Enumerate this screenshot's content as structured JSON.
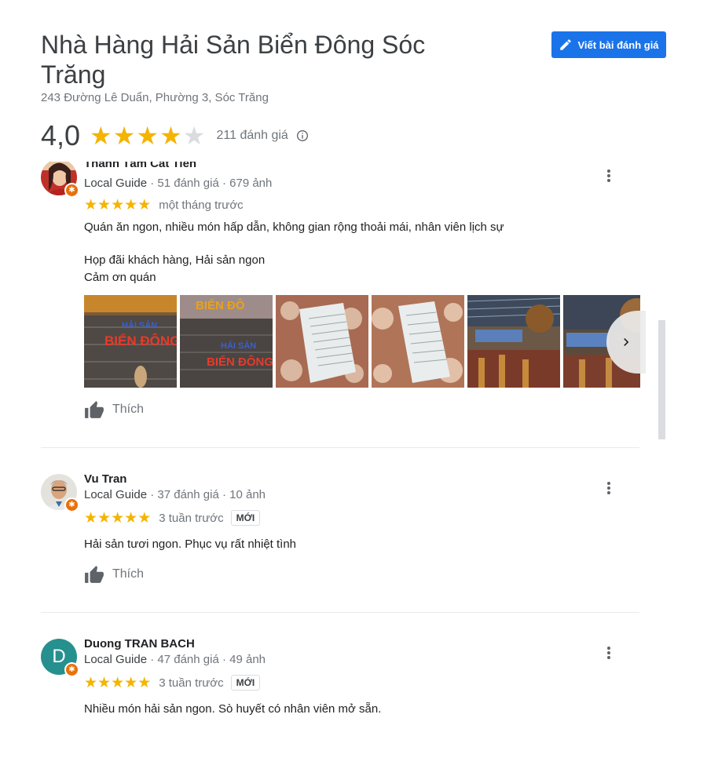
{
  "place": {
    "title": "Nhà Hàng Hải Sản Biển Đông Sóc Trăng",
    "address": "243 Đường Lê Duẩn, Phường 3, Sóc Trăng",
    "rating": "4,0",
    "rating_value": 4.0,
    "review_count": "211 đánh giá"
  },
  "write_review": {
    "label": "Viết bài đánh giá"
  },
  "colors": {
    "accent": "#1a73e8",
    "star": "#f4b400",
    "guide_badge": "#e8710a",
    "avatar_teal": "#26908f"
  },
  "reviews": [
    {
      "name": "Thanh Tâm Cát Tiên",
      "local_guide": "Local Guide",
      "meta": " · 51 đánh giá · 679 ảnh",
      "stars": 5,
      "date": "một tháng trước",
      "text_lines": [
        "Quán ăn ngon, nhiều món hấp dẫn, không gian rộng thoải mái, nhân viên lịch sự",
        "Họp đãi khách hàng, Hải sản ngon",
        "Cảm ơn quán"
      ],
      "photos": [
        {
          "label_lines": [
            "HẢI SẢN",
            "BIỂN ĐÔNG"
          ]
        },
        {
          "label_lines": [
            "BIỂN ĐÔ",
            "HẢI SẢN",
            "BIỂN ĐÔNG"
          ]
        },
        {
          "label_lines": []
        },
        {
          "label_lines": []
        },
        {
          "label_lines": []
        },
        {
          "label_lines": []
        }
      ],
      "like_label": "Thích"
    },
    {
      "name": "Vu Tran",
      "local_guide": "Local Guide",
      "meta": " · 37 đánh giá · 10 ảnh",
      "stars": 5,
      "date": "3 tuần trước",
      "badge": "MỚI",
      "text_lines": [
        "Hải sản tươi ngon. Phục vụ rất nhiệt tình"
      ],
      "like_label": "Thích"
    },
    {
      "name": "Duong TRAN BACH",
      "avatar_letter": "D",
      "local_guide": "Local Guide",
      "meta": " · 47 đánh giá · 49 ảnh",
      "stars": 5,
      "date": "3 tuần trước",
      "badge": "MỚI",
      "text_lines": [
        "Nhiều món hải sản ngon. Sò huyết có nhân viên mở sẵn."
      ]
    }
  ]
}
